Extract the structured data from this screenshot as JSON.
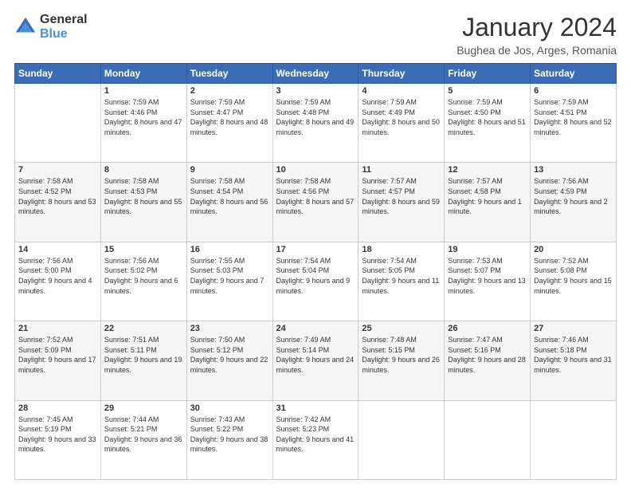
{
  "logo": {
    "general": "General",
    "blue": "Blue"
  },
  "header": {
    "month_year": "January 2024",
    "location": "Bughea de Jos, Arges, Romania"
  },
  "weekdays": [
    "Sunday",
    "Monday",
    "Tuesday",
    "Wednesday",
    "Thursday",
    "Friday",
    "Saturday"
  ],
  "weeks": [
    [
      {
        "day": "",
        "info": ""
      },
      {
        "day": "1",
        "info": "Sunrise: 7:59 AM\nSunset: 4:46 PM\nDaylight: 8 hours and 47 minutes."
      },
      {
        "day": "2",
        "info": "Sunrise: 7:59 AM\nSunset: 4:47 PM\nDaylight: 8 hours and 48 minutes."
      },
      {
        "day": "3",
        "info": "Sunrise: 7:59 AM\nSunset: 4:48 PM\nDaylight: 8 hours and 49 minutes."
      },
      {
        "day": "4",
        "info": "Sunrise: 7:59 AM\nSunset: 4:49 PM\nDaylight: 8 hours and 50 minutes."
      },
      {
        "day": "5",
        "info": "Sunrise: 7:59 AM\nSunset: 4:50 PM\nDaylight: 8 hours and 51 minutes."
      },
      {
        "day": "6",
        "info": "Sunrise: 7:59 AM\nSunset: 4:51 PM\nDaylight: 8 hours and 52 minutes."
      }
    ],
    [
      {
        "day": "7",
        "info": "Sunrise: 7:58 AM\nSunset: 4:52 PM\nDaylight: 8 hours and 53 minutes."
      },
      {
        "day": "8",
        "info": "Sunrise: 7:58 AM\nSunset: 4:53 PM\nDaylight: 8 hours and 55 minutes."
      },
      {
        "day": "9",
        "info": "Sunrise: 7:58 AM\nSunset: 4:54 PM\nDaylight: 8 hours and 56 minutes."
      },
      {
        "day": "10",
        "info": "Sunrise: 7:58 AM\nSunset: 4:56 PM\nDaylight: 8 hours and 57 minutes."
      },
      {
        "day": "11",
        "info": "Sunrise: 7:57 AM\nSunset: 4:57 PM\nDaylight: 8 hours and 59 minutes."
      },
      {
        "day": "12",
        "info": "Sunrise: 7:57 AM\nSunset: 4:58 PM\nDaylight: 9 hours and 1 minute."
      },
      {
        "day": "13",
        "info": "Sunrise: 7:56 AM\nSunset: 4:59 PM\nDaylight: 9 hours and 2 minutes."
      }
    ],
    [
      {
        "day": "14",
        "info": "Sunrise: 7:56 AM\nSunset: 5:00 PM\nDaylight: 9 hours and 4 minutes."
      },
      {
        "day": "15",
        "info": "Sunrise: 7:56 AM\nSunset: 5:02 PM\nDaylight: 9 hours and 6 minutes."
      },
      {
        "day": "16",
        "info": "Sunrise: 7:55 AM\nSunset: 5:03 PM\nDaylight: 9 hours and 7 minutes."
      },
      {
        "day": "17",
        "info": "Sunrise: 7:54 AM\nSunset: 5:04 PM\nDaylight: 9 hours and 9 minutes."
      },
      {
        "day": "18",
        "info": "Sunrise: 7:54 AM\nSunset: 5:05 PM\nDaylight: 9 hours and 11 minutes."
      },
      {
        "day": "19",
        "info": "Sunrise: 7:53 AM\nSunset: 5:07 PM\nDaylight: 9 hours and 13 minutes."
      },
      {
        "day": "20",
        "info": "Sunrise: 7:52 AM\nSunset: 5:08 PM\nDaylight: 9 hours and 15 minutes."
      }
    ],
    [
      {
        "day": "21",
        "info": "Sunrise: 7:52 AM\nSunset: 5:09 PM\nDaylight: 9 hours and 17 minutes."
      },
      {
        "day": "22",
        "info": "Sunrise: 7:51 AM\nSunset: 5:11 PM\nDaylight: 9 hours and 19 minutes."
      },
      {
        "day": "23",
        "info": "Sunrise: 7:50 AM\nSunset: 5:12 PM\nDaylight: 9 hours and 22 minutes."
      },
      {
        "day": "24",
        "info": "Sunrise: 7:49 AM\nSunset: 5:14 PM\nDaylight: 9 hours and 24 minutes."
      },
      {
        "day": "25",
        "info": "Sunrise: 7:48 AM\nSunset: 5:15 PM\nDaylight: 9 hours and 26 minutes."
      },
      {
        "day": "26",
        "info": "Sunrise: 7:47 AM\nSunset: 5:16 PM\nDaylight: 9 hours and 28 minutes."
      },
      {
        "day": "27",
        "info": "Sunrise: 7:46 AM\nSunset: 5:18 PM\nDaylight: 9 hours and 31 minutes."
      }
    ],
    [
      {
        "day": "28",
        "info": "Sunrise: 7:45 AM\nSunset: 5:19 PM\nDaylight: 9 hours and 33 minutes."
      },
      {
        "day": "29",
        "info": "Sunrise: 7:44 AM\nSunset: 5:21 PM\nDaylight: 9 hours and 36 minutes."
      },
      {
        "day": "30",
        "info": "Sunrise: 7:43 AM\nSunset: 5:22 PM\nDaylight: 9 hours and 38 minutes."
      },
      {
        "day": "31",
        "info": "Sunrise: 7:42 AM\nSunset: 5:23 PM\nDaylight: 9 hours and 41 minutes."
      },
      {
        "day": "",
        "info": ""
      },
      {
        "day": "",
        "info": ""
      },
      {
        "day": "",
        "info": ""
      }
    ]
  ]
}
